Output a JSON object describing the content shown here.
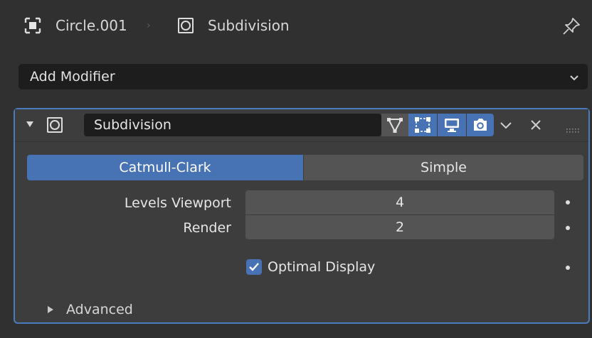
{
  "header": {
    "object_name": "Circle.001",
    "separator": "›",
    "modifier_name": "Subdivision",
    "object_icon": "object-data-icon",
    "modifier_icon": "modifier-subdivision-icon",
    "pin_icon": "pin-icon"
  },
  "add_modifier": {
    "label": "Add Modifier",
    "chevron_icon": "chevron-down-icon"
  },
  "modifier_panel": {
    "name_value": "Subdivision",
    "toggles": [
      {
        "name": "edit-mode-toggle",
        "icon": "edit-mode-icon",
        "active": false
      },
      {
        "name": "on-cage-toggle",
        "icon": "on-cage-icon",
        "active": true
      },
      {
        "name": "viewport-toggle",
        "icon": "monitor-icon",
        "active": true
      },
      {
        "name": "render-toggle",
        "icon": "camera-icon",
        "active": true
      }
    ],
    "subdivision_types": [
      "Catmull-Clark",
      "Simple"
    ],
    "selected_type": "Catmull-Clark",
    "levels_viewport": {
      "label": "Levels Viewport",
      "value": "4"
    },
    "render": {
      "label": "Render",
      "value": "2"
    },
    "optimal_display": {
      "label": "Optimal Display",
      "checked": true
    },
    "advanced_label": "Advanced"
  },
  "colors": {
    "accent": "#4772b3",
    "panel_border": "#4a7bbf",
    "background": "#303030",
    "panel_bg": "#3d3d3d",
    "field_bg": "#545454",
    "dark_field": "#1d1d1d"
  }
}
